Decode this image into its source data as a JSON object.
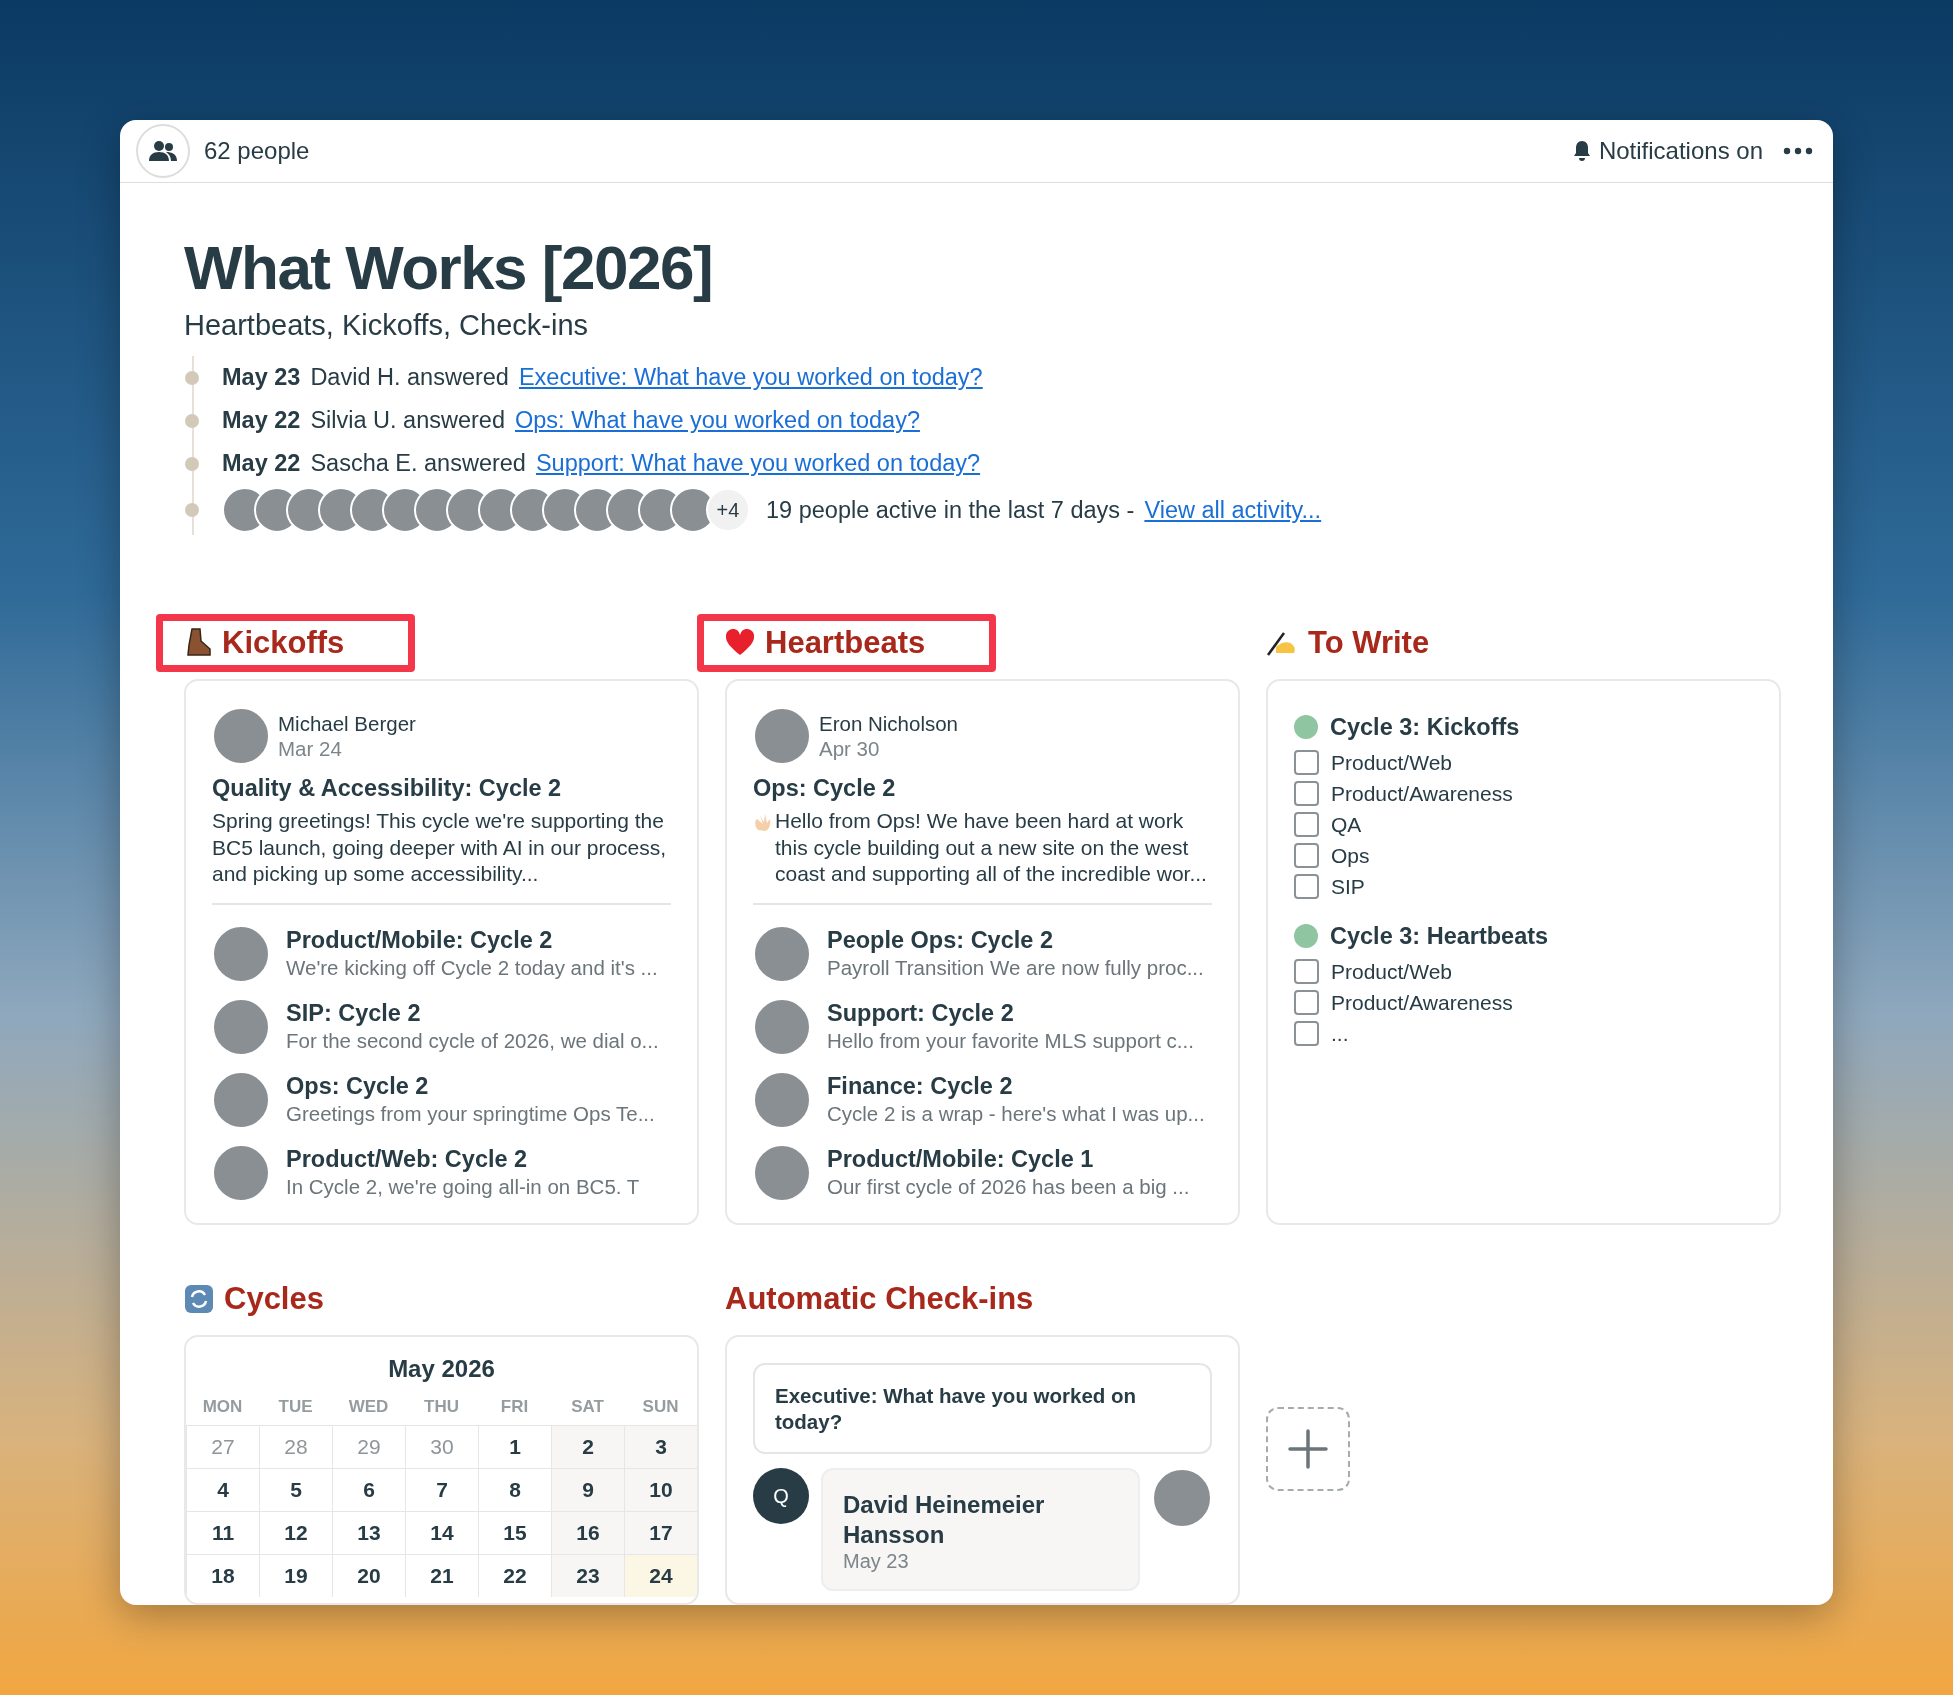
{
  "header": {
    "people_count": "62 people",
    "notifications": "Notifications on"
  },
  "title": "What Works [2026]",
  "subtitle": "Heartbeats, Kickoffs, Check-ins",
  "activity": [
    {
      "date": "May 23",
      "text": "David H. answered",
      "link": "Executive: What have you worked on today?"
    },
    {
      "date": "May 22",
      "text": "Silvia U. answered",
      "link": "Ops: What have you worked on today?"
    },
    {
      "date": "May 22",
      "text": "Sascha E. answered",
      "link": "Support: What have you worked on today?"
    }
  ],
  "active": {
    "more": "+4",
    "text": "19 people active in the last 7 days -",
    "link": "View all activity..."
  },
  "kickoffs": {
    "heading": "Kickoffs",
    "highlighted": true,
    "featured": {
      "author": "Michael Berger",
      "date": "Mar 24",
      "title": "Quality & Accessibility: Cycle 2",
      "excerpt": "Spring greetings! This cycle we're supporting the BC5 launch, going deeper with AI in our process, and picking up some accessibility..."
    },
    "posts": [
      {
        "title": "Product/Mobile: Cycle 2",
        "excerpt": "We're kicking off Cycle 2 today and it's ..."
      },
      {
        "title": "SIP: Cycle 2",
        "excerpt": "For the second cycle of 2026, we dial o..."
      },
      {
        "title": "Ops: Cycle 2",
        "excerpt": "Greetings from your springtime Ops Te..."
      },
      {
        "title": "Product/Web: Cycle 2",
        "excerpt": "In Cycle 2, we're going all-in on BC5. T"
      }
    ]
  },
  "heartbeats": {
    "heading": "Heartbeats",
    "highlighted": true,
    "featured": {
      "author": "Eron Nicholson",
      "date": "Apr 30",
      "title": "Ops: Cycle 2",
      "excerpt": "Hello from Ops! We have been hard at work this cycle building out a new site on the west coast and supporting all of the incredible wor..."
    },
    "posts": [
      {
        "title": "People Ops: Cycle 2",
        "excerpt": "Payroll Transition We are now fully proc..."
      },
      {
        "title": "Support: Cycle 2",
        "excerpt": "Hello from your favorite MLS support c..."
      },
      {
        "title": "Finance: Cycle 2",
        "excerpt": "Cycle 2 is a wrap - here's what I was up..."
      },
      {
        "title": "Product/Mobile: Cycle 1",
        "excerpt": "Our first cycle of 2026 has been a big ..."
      }
    ]
  },
  "to_write": {
    "heading": "To Write",
    "highlighted": false,
    "groups": [
      {
        "title": "Cycle 3: Kickoffs",
        "color": "#8fc5a0",
        "items": [
          {
            "label": "Product/Web",
            "checked": false
          },
          {
            "label": "Product/Awareness",
            "checked": false
          },
          {
            "label": "QA",
            "checked": false
          },
          {
            "label": "Ops",
            "checked": false
          },
          {
            "label": "SIP",
            "checked": false
          }
        ]
      },
      {
        "title": "Cycle 3: Heartbeats",
        "color": "#8fc5a0",
        "items": [
          {
            "label": "Product/Web",
            "checked": false
          },
          {
            "label": "Product/Awareness",
            "checked": false
          },
          {
            "label": "...",
            "checked": false
          }
        ]
      }
    ]
  },
  "cycles": {
    "heading": "Cycles",
    "month": "May 2026",
    "weekdays": [
      "MON",
      "TUE",
      "WED",
      "THU",
      "FRI",
      "SAT",
      "SUN"
    ],
    "weeks": [
      [
        {
          "day": "27",
          "outside": true,
          "today": false
        },
        {
          "day": "28",
          "outside": true,
          "today": false
        },
        {
          "day": "29",
          "outside": true,
          "today": false
        },
        {
          "day": "30",
          "outside": true,
          "today": false
        },
        {
          "day": "1",
          "outside": false,
          "today": false
        },
        {
          "day": "2",
          "outside": false,
          "today": false
        },
        {
          "day": "3",
          "outside": false,
          "today": false
        }
      ],
      [
        {
          "day": "4",
          "outside": false,
          "today": false
        },
        {
          "day": "5",
          "outside": false,
          "today": false
        },
        {
          "day": "6",
          "outside": false,
          "today": false
        },
        {
          "day": "7",
          "outside": false,
          "today": false
        },
        {
          "day": "8",
          "outside": false,
          "today": false
        },
        {
          "day": "9",
          "outside": false,
          "today": false
        },
        {
          "day": "10",
          "outside": false,
          "today": false
        }
      ],
      [
        {
          "day": "11",
          "outside": false,
          "today": false
        },
        {
          "day": "12",
          "outside": false,
          "today": false
        },
        {
          "day": "13",
          "outside": false,
          "today": false
        },
        {
          "day": "14",
          "outside": false,
          "today": false
        },
        {
          "day": "15",
          "outside": false,
          "today": false
        },
        {
          "day": "16",
          "outside": false,
          "today": false
        },
        {
          "day": "17",
          "outside": false,
          "today": false
        }
      ],
      [
        {
          "day": "18",
          "outside": false,
          "today": false
        },
        {
          "day": "19",
          "outside": false,
          "today": false
        },
        {
          "day": "20",
          "outside": false,
          "today": false
        },
        {
          "day": "21",
          "outside": false,
          "today": false
        },
        {
          "day": "22",
          "outside": false,
          "today": false
        },
        {
          "day": "23",
          "outside": false,
          "today": false
        },
        {
          "day": "24",
          "outside": false,
          "today": true
        }
      ]
    ]
  },
  "checkins": {
    "heading": "Automatic Check-ins",
    "question": "Executive: What have you worked on today?",
    "q_label": "Q",
    "answer_author": "David Heinemeier Hansson",
    "answer_date": "May 23"
  }
}
